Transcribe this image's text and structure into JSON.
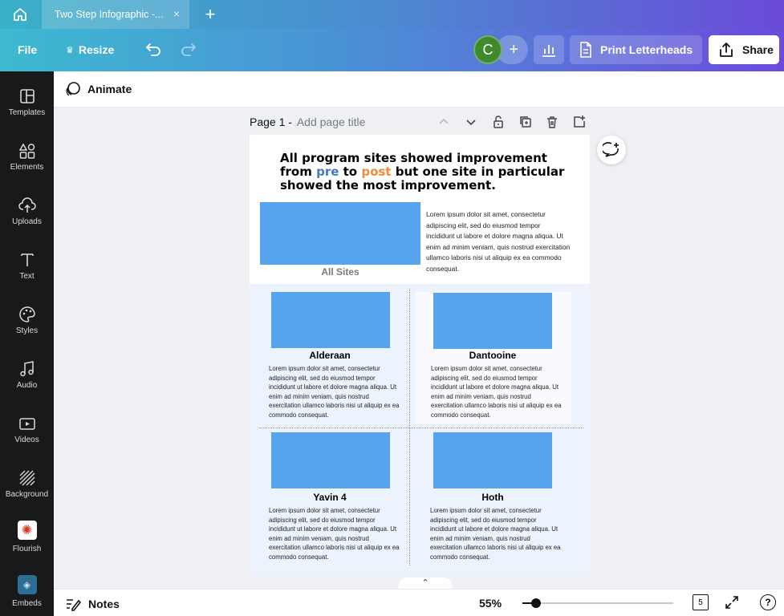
{
  "tabbar": {
    "tab_title": "Two Step Infographic -...",
    "close_icon": "×",
    "new_tab_icon": "+"
  },
  "toolbar": {
    "file_label": "File",
    "resize_label": "Resize",
    "avatar_initial": "C",
    "add_collaborator": "+",
    "print_label": "Print Letterheads",
    "share_label": "Share"
  },
  "sidebar": {
    "items": [
      {
        "label": "Templates",
        "icon": "templates-icon"
      },
      {
        "label": "Elements",
        "icon": "elements-icon"
      },
      {
        "label": "Uploads",
        "icon": "uploads-icon"
      },
      {
        "label": "Text",
        "icon": "text-icon"
      },
      {
        "label": "Styles",
        "icon": "styles-icon"
      },
      {
        "label": "Audio",
        "icon": "audio-icon"
      },
      {
        "label": "Videos",
        "icon": "videos-icon"
      },
      {
        "label": "Background",
        "icon": "background-icon"
      },
      {
        "label": "Flourish",
        "icon": "flourish-icon"
      },
      {
        "label": "Embeds",
        "icon": "embeds-icon"
      }
    ]
  },
  "animate": {
    "label": "Animate"
  },
  "page_header": {
    "page": "Page 1 -",
    "title_placeholder": "Add page title"
  },
  "design": {
    "headline_a": "All program sites showed improvement from ",
    "headline_pre": "pre",
    "headline_to": " to ",
    "headline_post": "post",
    "headline_b": " but one site in particular showed the most improvement.",
    "all_sites_label": "All Sites",
    "top_paragraph": "Lorem ipsum dolor sit amet, consectetur adipiscing elit, sed do eiusmod tempor incididunt ut labore et dolore magna aliqua. Ut enim ad minim veniam, quis nostrud exercitation ullamco laboris nisi ut aliquip ex ea commodo consequat.",
    "cells": [
      {
        "title": "Alderaan",
        "text": "Lorem ipsum dolor sit amet, consectetur adipiscing elit, sed do eiusmod tempor incididunt ut labore et dolore magna aliqua. Ut enim ad minim veniam, quis nostrud exercitation ullamco laboris nisi ut aliquip ex ea commodo consequat."
      },
      {
        "title": "Dantooine",
        "text": "Lorem ipsum dolor sit amet, consectetur adipiscing elit, sed do eiusmod tempor incididunt ut labore et dolore magna aliqua. Ut enim ad minim veniam, quis nostrud exercitation ullamco laboris nisi ut aliquip ex ea commodo consequat."
      },
      {
        "title": "Yavin 4",
        "text": "Lorem ipsum dolor sit amet, consectetur adipiscing elit, sed do eiusmod tempor incididunt ut labore et dolore magna aliqua. Ut enim ad minim veniam, quis nostrud exercitation ullamco laboris nisi ut aliquip ex ea commodo consequat."
      },
      {
        "title": "Hoth",
        "text": "Lorem ipsum dolor sit amet, consectetur adipiscing elit, sed do eiusmod tempor incididunt ut labore et dolore magna aliqua. Ut enim ad minim veniam, quis nostrud exercitation ullamco laboris nisi ut aliquip ex ea commodo consequat."
      }
    ],
    "colors": {
      "pre": "#4a76c2",
      "post": "#f08a3c",
      "placeholder": "#56a3ee"
    }
  },
  "bottombar": {
    "notes_label": "Notes",
    "zoom_label": "55%",
    "zoom_fraction": 0.09,
    "page_count": "5",
    "help_label": "?"
  }
}
